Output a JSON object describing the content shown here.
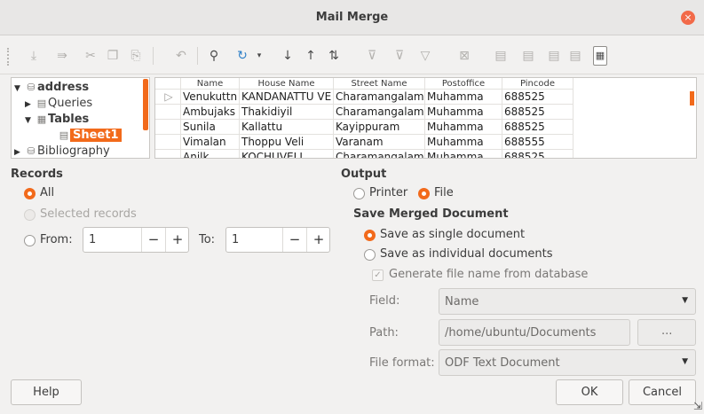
{
  "window": {
    "title": "Mail Merge",
    "close_symbol": "×"
  },
  "toolbar": {
    "icons": [
      "insert-record-icon",
      "data-to-fields-icon",
      "cut-icon",
      "copy-icon",
      "paste-icon",
      "undo-icon",
      "find-record-icon",
      "refresh-icon",
      "refresh-dropdown-icon",
      "sort-ascending-icon",
      "sort-descending-icon",
      "sort-icon",
      "autofilter-icon",
      "apply-filter-icon",
      "standard-filter-icon",
      "reset-filter-icon",
      "data-to-text-icon",
      "data-to-fields-icon-2",
      "mail-merge-icon",
      "data-source-icon",
      "explorer-icon"
    ]
  },
  "tree": {
    "items": [
      {
        "label": "address",
        "icon": "database-icon"
      },
      {
        "label": "Queries",
        "icon": "queries-icon"
      },
      {
        "label": "Tables",
        "icon": "tables-icon"
      },
      {
        "label": "Sheet1",
        "icon": "sheet-icon"
      },
      {
        "label": "Bibliography",
        "icon": "database-icon"
      }
    ]
  },
  "grid": {
    "columns": [
      "Name",
      "House Name",
      "Street Name",
      "Postoffice",
      "Pincode"
    ],
    "rows": [
      [
        "Venukuttn",
        "KANDANATTU VE",
        "Charamangalam",
        "Muhamma",
        "688525"
      ],
      [
        "Ambujaks",
        "Thakidiyil",
        "Charamangalam",
        "Muhamma",
        "688525"
      ],
      [
        "Sunila",
        "Kallattu",
        "Kayippuram",
        "Muhamma",
        "688525"
      ],
      [
        "Vimalan",
        "Thoppu Veli",
        "Varanam",
        "Muhamma",
        "688555"
      ],
      [
        "Anilk",
        "KOCHUVELI",
        "Charamangalam",
        "Muhamma",
        "688525"
      ]
    ],
    "row_marker": "▷"
  },
  "records": {
    "heading": "Records",
    "all_label": "All",
    "selected_label": "Selected records",
    "from_label": "From:",
    "from_value": "1",
    "to_label": "To:",
    "to_value": "1",
    "minus": "−",
    "plus": "+"
  },
  "output": {
    "heading": "Output",
    "printer_label": "Printer",
    "file_label": "File",
    "save_heading": "Save Merged Document",
    "single_label": "Save as single document",
    "individual_label": "Save as individual documents",
    "generate_label": "Generate file name from database",
    "field_label": "Field:",
    "field_value": "Name",
    "path_label": "Path:",
    "path_value": "/home/ubuntu/Documents",
    "browse_label": "...",
    "format_label": "File format:",
    "format_value": "ODF Text Document"
  },
  "buttons": {
    "help": "Help",
    "ok": "OK",
    "cancel": "Cancel"
  },
  "colors": {
    "accent": "#f26a1b",
    "close": "#f26a49"
  }
}
